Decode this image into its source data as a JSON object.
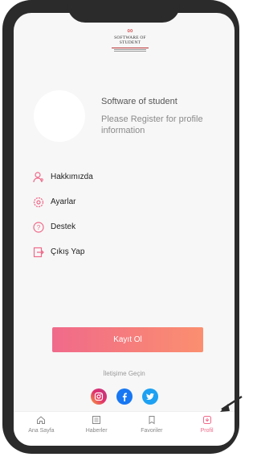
{
  "brand": {
    "logo_text_line1": "SOFTWARE OF",
    "logo_text_line2": "STUDENT"
  },
  "profile": {
    "name": "Software of student",
    "info": "Please Register for profile information"
  },
  "menu": {
    "items": [
      {
        "label": "Hakkımızda",
        "icon": "user-icon"
      },
      {
        "label": "Ayarlar",
        "icon": "gear-icon"
      },
      {
        "label": "Destek",
        "icon": "help-icon"
      },
      {
        "label": "Çıkış Yap",
        "icon": "logout-icon"
      }
    ]
  },
  "register_button": {
    "label": "Kayıt Ol"
  },
  "contact": {
    "label": "İletişime Geçin"
  },
  "social": [
    {
      "icon": "instagram-icon"
    },
    {
      "icon": "facebook-icon"
    },
    {
      "icon": "twitter-icon"
    }
  ],
  "bottom_nav": {
    "items": [
      {
        "label": "Ana Sayfa",
        "icon": "home-icon"
      },
      {
        "label": "Haberler",
        "icon": "news-icon"
      },
      {
        "label": "Favoriler",
        "icon": "bookmark-icon"
      },
      {
        "label": "Profil",
        "icon": "profile-icon"
      }
    ]
  },
  "colors": {
    "accent": "#f06a8a",
    "frame": "#2b2b2b",
    "background": "#f7f7f7"
  }
}
